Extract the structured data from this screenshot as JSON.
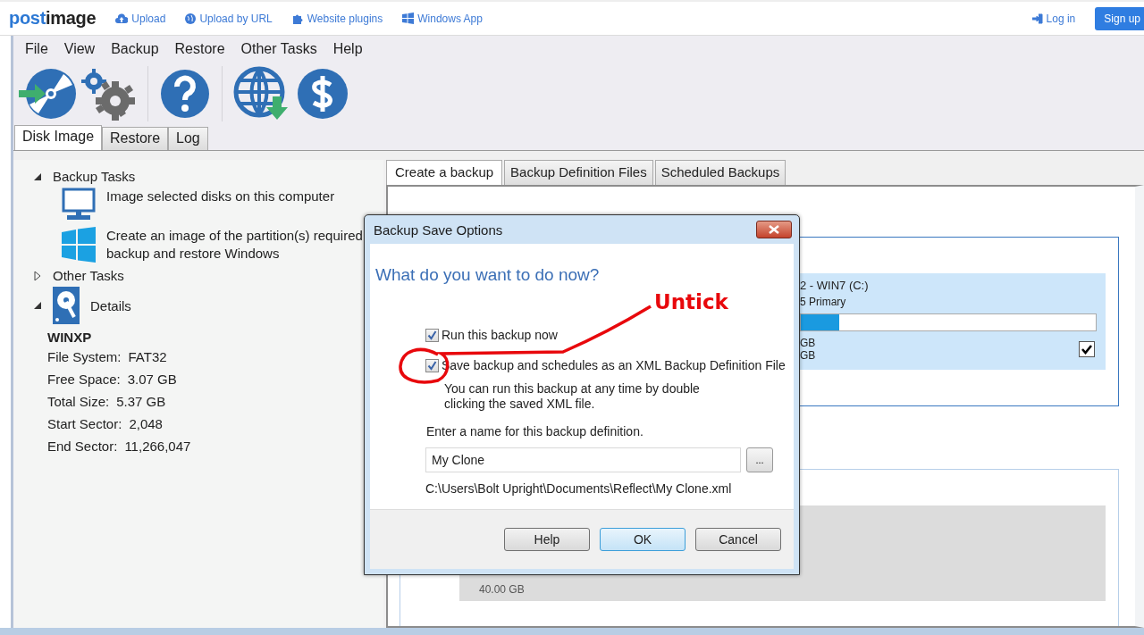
{
  "site": {
    "logo": {
      "first": "post",
      "second": "image"
    },
    "links": [
      "Upload",
      "Upload by URL",
      "Website plugins",
      "Windows App"
    ],
    "login": "Log in",
    "signup": "Sign up"
  },
  "menu": [
    "File",
    "View",
    "Backup",
    "Restore",
    "Other Tasks",
    "Help"
  ],
  "main_tabs": [
    {
      "label": "Disk Image",
      "selected": true
    },
    {
      "label": "Restore",
      "selected": false
    },
    {
      "label": "Log",
      "selected": false
    }
  ],
  "tasks": [
    {
      "title": "Backup Tasks",
      "expanded": true,
      "items": [
        "Image selected disks on this computer",
        "Create an image of the partition(s) required backup and restore Windows"
      ]
    },
    {
      "title": "Other Tasks",
      "expanded": false
    },
    {
      "title": "Details",
      "expanded": true
    }
  ],
  "details": {
    "name": "WINXP",
    "rows": [
      {
        "label": "File System:",
        "value": "FAT32"
      },
      {
        "label": "Free Space:",
        "value": "3.07 GB"
      },
      {
        "label": "Total Size:",
        "value": "5.37 GB"
      },
      {
        "label": "Start Sector:",
        "value": "2,048"
      },
      {
        "label": "End Sector:",
        "value": "11,266,047"
      }
    ]
  },
  "backup_tabs": [
    {
      "label": "Create a backup",
      "selected": true
    },
    {
      "label": "Backup Definition Files",
      "selected": false
    },
    {
      "label": "Scheduled Backups",
      "selected": false
    }
  ],
  "partition": {
    "title": "2 - WIN7 (C:)",
    "type": "5 Primary",
    "level": 0.13,
    "size_1": "GB",
    "size_2": "GB",
    "checked": true
  },
  "disk_size": "40.00 GB",
  "dialog": {
    "title": "Backup Save Options",
    "heading": "What do you want to do now?",
    "options": [
      {
        "label": "Run this backup now",
        "checked": true
      },
      {
        "label": "Save backup and schedules as an XML Backup Definition File",
        "checked": true
      }
    ],
    "note": "You can run this backup at any time by double clicking the saved XML file.",
    "name_label": "Enter a name for this backup definition.",
    "name_value": "My Clone",
    "browse": "...",
    "path": "C:\\Users\\Bolt Upright\\Documents\\Reflect\\My Clone.xml",
    "buttons": [
      {
        "label": "Help",
        "default": false
      },
      {
        "label": "OK",
        "default": true
      },
      {
        "label": "Cancel",
        "default": false
      }
    ]
  },
  "annotation": {
    "text": "Untick"
  }
}
